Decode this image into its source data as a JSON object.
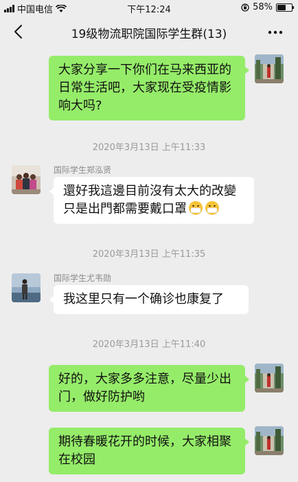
{
  "status_bar": {
    "carrier": "中国电信",
    "time": "下午12:24",
    "battery_percent": "58%",
    "battery_level": 0.58
  },
  "nav": {
    "title": "19级物流职院国际学生群(13)",
    "back_icon": "chevron-left-icon",
    "more_icon": "more-dots-icon"
  },
  "messages": [
    {
      "type": "outgoing",
      "text": "大家分享一下你们在马来西亚的日常生活吧，大家现在受疫情影响大吗?"
    },
    {
      "type": "timestamp",
      "text": "2020年3月13日 上午11:33"
    },
    {
      "type": "incoming",
      "sender": "国际学生郑泓贤",
      "text": "還好我這邊目前沒有太大的改變只是出門都需要戴口罩",
      "emoji": "mask-face-icon"
    },
    {
      "type": "timestamp",
      "text": "2020年3月13日 上午11:35"
    },
    {
      "type": "incoming",
      "sender": "国际学生尤韦勋",
      "text": "我这里只有一个确诊也康复了"
    },
    {
      "type": "timestamp",
      "text": "2020年3月13日 上午11:40"
    },
    {
      "type": "outgoing",
      "text": "好的，大家多多注意，尽量少出门，做好防护哟"
    },
    {
      "type": "outgoing",
      "text": "期待春暖花开的时候，大家相聚在校园"
    }
  ]
}
